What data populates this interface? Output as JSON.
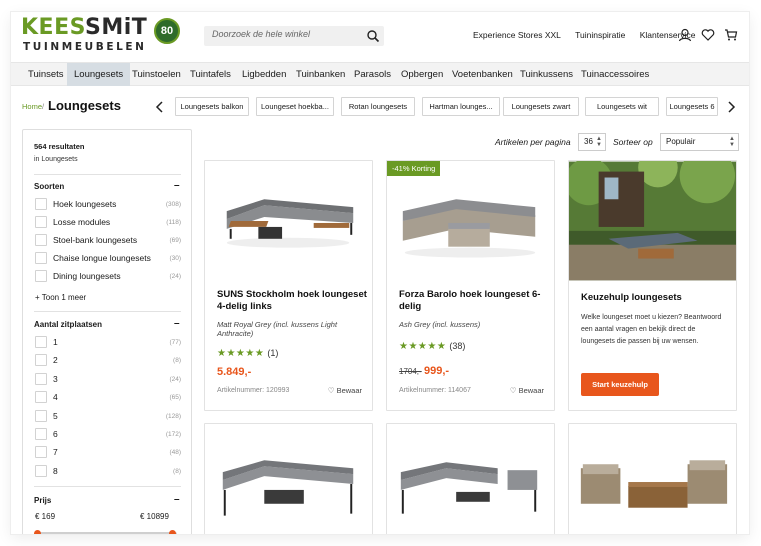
{
  "brand": {
    "logo_word_part1": "KEES",
    "logo_word_part2": "SMiT",
    "logo_sub": "TUINMEUBELEN",
    "logo_badge": "80"
  },
  "search": {
    "placeholder": "Doorzoek de hele winkel"
  },
  "top_links": [
    "Experience Stores XXL",
    "Tuininspiratie",
    "Klantenservice"
  ],
  "header_icons": [
    "account-icon",
    "heart-icon",
    "cart-icon"
  ],
  "nav": {
    "items": [
      "Tuinsets",
      "Loungesets",
      "Tuinstoelen",
      "Tuintafels",
      "Ligbedden",
      "Tuinbanken",
      "Parasols",
      "Opbergen",
      "Voetenbanken",
      "Tuinkussens",
      "Tuinaccessoires"
    ],
    "active": "Loungesets"
  },
  "breadcrumb": {
    "home": "Home",
    "separator": "/",
    "title": "Loungesets"
  },
  "chips": [
    "Loungesets balkon",
    "Loungeset hoekba...",
    "Rotan loungesets",
    "Hartman lounges...",
    "Loungesets zwart",
    "Loungesets wit",
    "Loungesets 6"
  ],
  "sidebar": {
    "result_count": "564 resultaten",
    "result_context": "in Loungesets",
    "soorten": {
      "title": "Soorten",
      "toggle": "–",
      "options": [
        {
          "label": "Hoek loungesets",
          "count": "(308)"
        },
        {
          "label": "Losse modules",
          "count": "(118)"
        },
        {
          "label": "Stoel-bank loungesets",
          "count": "(69)"
        },
        {
          "label": "Chaise longue loungesets",
          "count": "(30)"
        },
        {
          "label": "Dining loungesets",
          "count": "(24)"
        }
      ],
      "more": "+ Toon 1 meer"
    },
    "zitplaatsen": {
      "title": "Aantal zitplaatsen",
      "toggle": "–",
      "options": [
        {
          "label": "1",
          "count": "(77)"
        },
        {
          "label": "2",
          "count": "(8)"
        },
        {
          "label": "3",
          "count": "(24)"
        },
        {
          "label": "4",
          "count": "(65)"
        },
        {
          "label": "5",
          "count": "(128)"
        },
        {
          "label": "6",
          "count": "(172)"
        },
        {
          "label": "7",
          "count": "(48)"
        },
        {
          "label": "8",
          "count": "(8)"
        }
      ]
    },
    "prijs": {
      "title": "Prijs",
      "toggle": "–",
      "min": "€ 169",
      "max": "€ 10899"
    }
  },
  "sort": {
    "per_page_label": "Artikelen per pagina",
    "per_page_value": "36",
    "sort_label": "Sorteer op",
    "sort_value": "Populair"
  },
  "products": [
    {
      "name": "SUNS Stockholm hoek loungeset 4-delig links",
      "variant": "Matt Royal Grey (incl. kussens Light Anthracite)",
      "stars": "★★★★★",
      "rating_count": "(1)",
      "price": "5.849,-",
      "old_price": "",
      "artnr": "Artikelnummer: 120993",
      "save": "Bewaar",
      "badge": ""
    },
    {
      "name": "Forza Barolo hoek loungeset 6-delig",
      "variant": "Ash Grey (incl. kussens)",
      "stars": "★★★★★",
      "rating_count": "(38)",
      "price": "999,-",
      "old_price": "1704,-",
      "artnr": "Artikelnummer: 114067",
      "save": "Bewaar",
      "badge": "-41% Korting"
    }
  ],
  "keuzehulp": {
    "title": "Keuzehulp loungesets",
    "text": "Welke loungeset moet u kiezen? Beantwoord een aantal vragen en bekijk direct de loungesets die passen bij uw wensen.",
    "button": "Start keuzehulp"
  },
  "colors": {
    "brand_green": "#6a9a24",
    "accent_orange": "#e8561c",
    "nav_active": "#d6dde3"
  }
}
